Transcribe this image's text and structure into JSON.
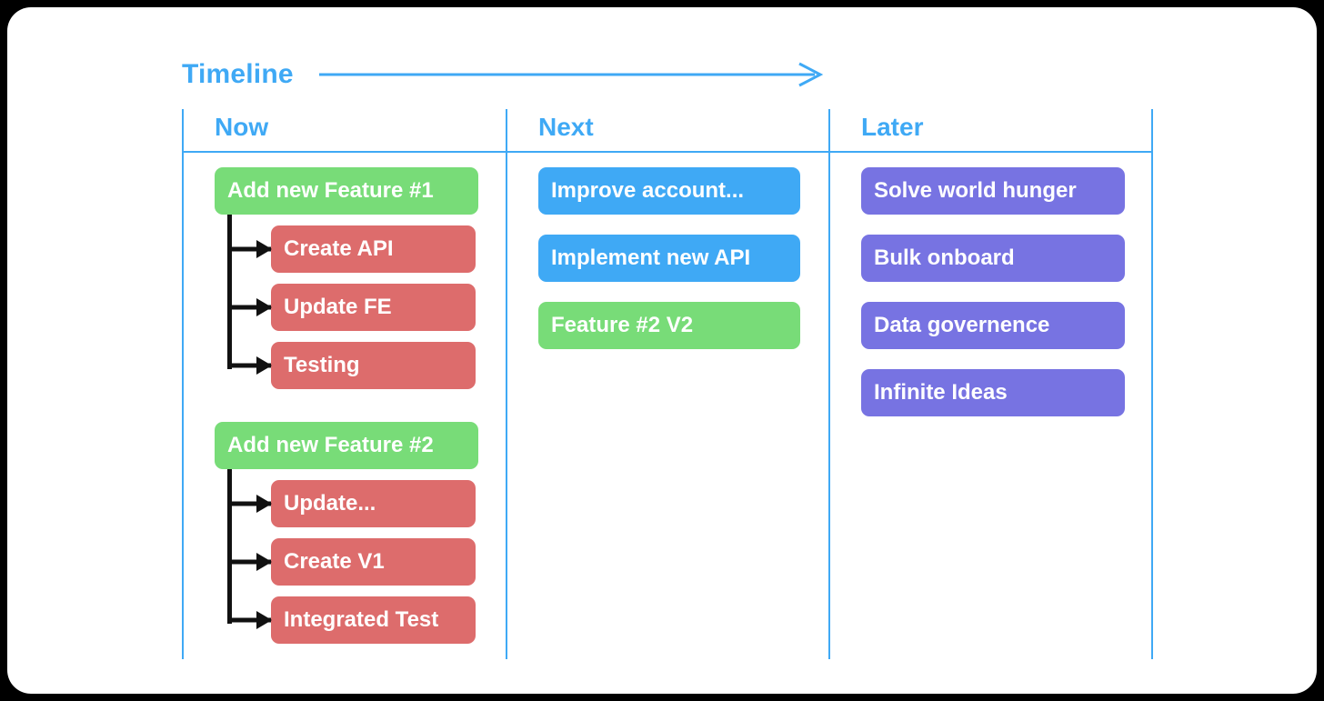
{
  "title": "Timeline",
  "colors": {
    "accent_blue": "#3FA9F5",
    "epic_green": "#78DC78",
    "task_red": "#DD6C6C",
    "item_blue": "#3FA9F5",
    "item_purple": "#7773E2",
    "connector_black": "#111111",
    "board_background": "#FFFFFF",
    "page_background": "#000000"
  },
  "timeline": {
    "label": "Timeline",
    "arrow_direction": "right"
  },
  "columns": [
    {
      "id": "now",
      "header": "Now",
      "groups": [
        {
          "epic": {
            "label": "Add new Feature #1",
            "color": "green"
          },
          "tasks": [
            {
              "label": "Create API",
              "color": "red"
            },
            {
              "label": "Update FE",
              "color": "red"
            },
            {
              "label": "Testing",
              "color": "red"
            }
          ]
        },
        {
          "epic": {
            "label": "Add new Feature #2",
            "color": "green"
          },
          "tasks": [
            {
              "label": "Update...",
              "color": "red"
            },
            {
              "label": "Create V1",
              "color": "red"
            },
            {
              "label": "Integrated Test",
              "color": "red"
            }
          ]
        }
      ]
    },
    {
      "id": "next",
      "header": "Next",
      "items": [
        {
          "label": "Improve account...",
          "color": "blue"
        },
        {
          "label": "Implement new API",
          "color": "blue"
        },
        {
          "label": "Feature #2 V2",
          "color": "green"
        }
      ]
    },
    {
      "id": "later",
      "header": "Later",
      "items": [
        {
          "label": "Solve world hunger",
          "color": "purple"
        },
        {
          "label": "Bulk onboard",
          "color": "purple"
        },
        {
          "label": "Data governence",
          "color": "purple"
        },
        {
          "label": "Infinite Ideas",
          "color": "purple"
        }
      ]
    }
  ]
}
